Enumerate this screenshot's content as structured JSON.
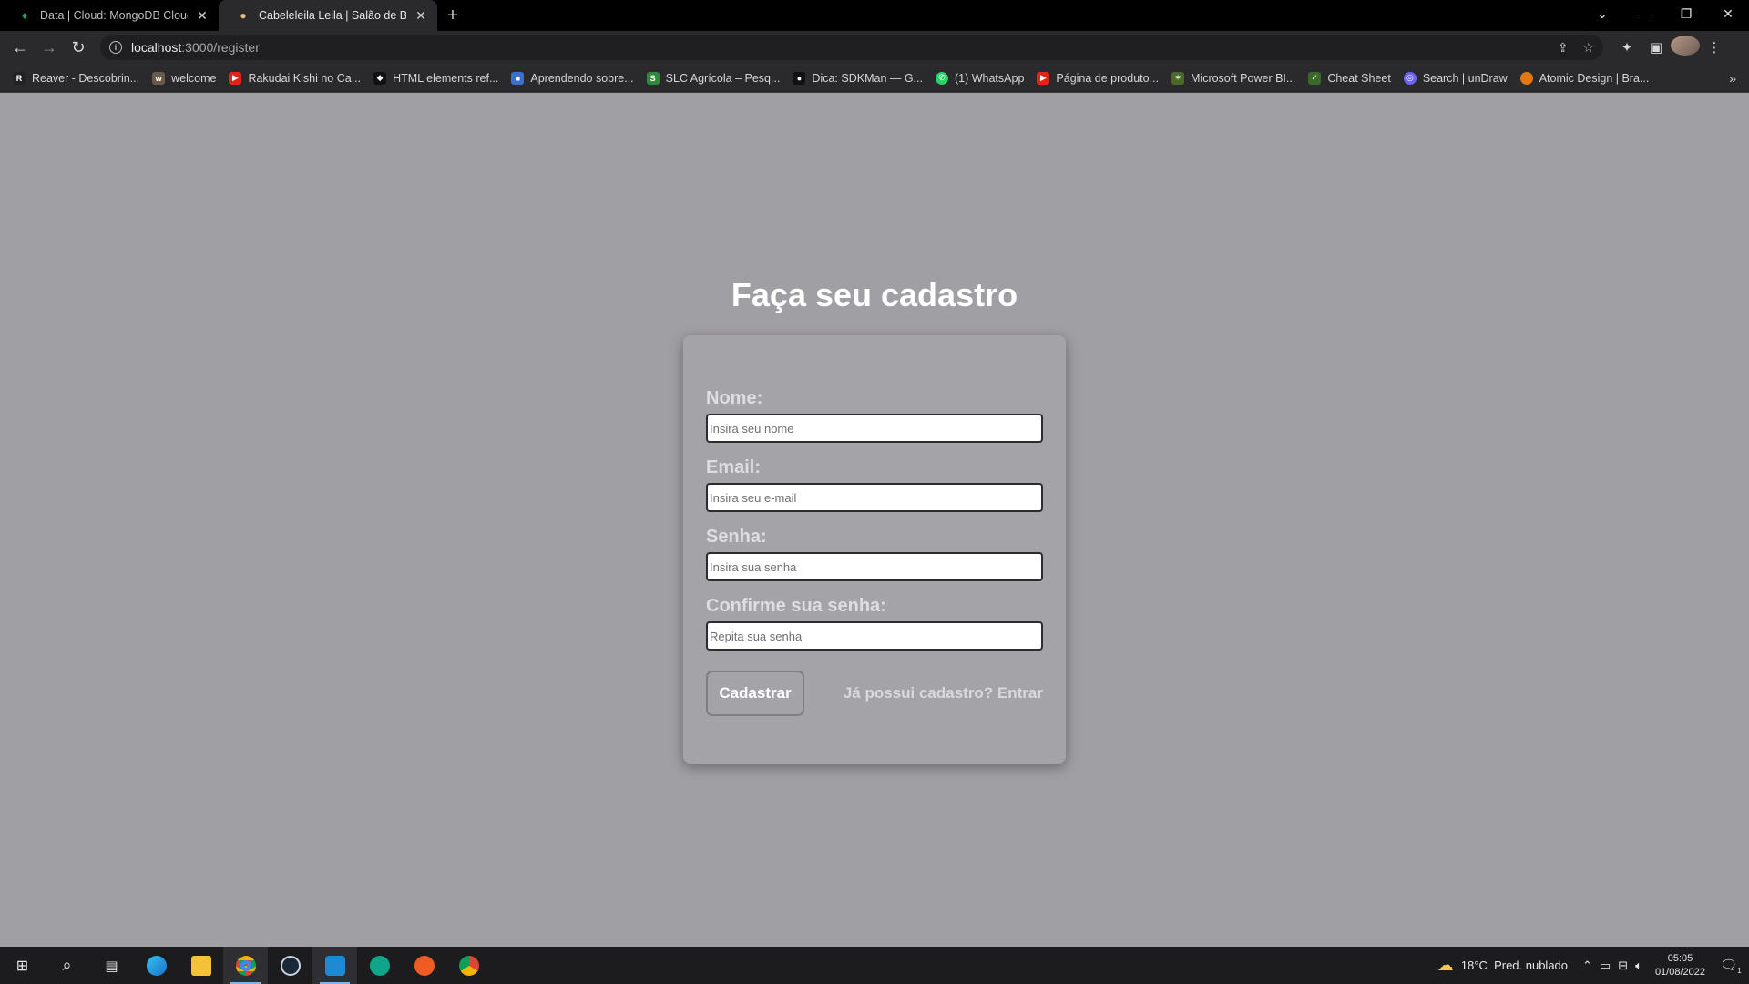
{
  "browser": {
    "tabs": [
      {
        "title": "Data | Cloud: MongoDB Cloud",
        "icon": "leaf-icon",
        "active": false
      },
      {
        "title": "Cabeleleila Leila | Salão de Beleza",
        "icon": "bulb-icon",
        "active": true
      }
    ],
    "url_host": "localhost",
    "url_path": ":3000/register",
    "bookmarks": [
      {
        "label": "Reaver - Descobrin...",
        "color": "#222222"
      },
      {
        "label": "welcome",
        "color": "#6b5a4a"
      },
      {
        "label": "Rakudai Kishi no Ca...",
        "color": "#e62117"
      },
      {
        "label": "HTML elements ref...",
        "color": "#111111"
      },
      {
        "label": "Aprendendo sobre...",
        "color": "#3b6fd1"
      },
      {
        "label": "SLC Agrícola – Pesq...",
        "color": "#2e8b3a"
      },
      {
        "label": "Dica: SDKMan — G...",
        "color": "#111111"
      },
      {
        "label": "(1) WhatsApp",
        "color": "#25d366"
      },
      {
        "label": "Página de produto...",
        "color": "#e62117"
      },
      {
        "label": "Microsoft Power BI...",
        "color": "#4a6a2a"
      },
      {
        "label": "Cheat Sheet",
        "color": "#3a6a2a"
      },
      {
        "label": "Search | unDraw",
        "color": "#6c63ff"
      },
      {
        "label": "Atomic Design | Bra...",
        "color": "#e07a10"
      }
    ]
  },
  "page": {
    "title": "Faça seu cadastro",
    "fields": [
      {
        "label": "Nome:",
        "placeholder": "Insira seu nome"
      },
      {
        "label": "Email:",
        "placeholder": "Insira seu e-mail"
      },
      {
        "label": "Senha:",
        "placeholder": "Insira sua senha"
      },
      {
        "label": "Confirme sua senha:",
        "placeholder": "Repita sua senha"
      }
    ],
    "submit_label": "Cadastrar",
    "login_link": "Já possui cadastro? Entrar"
  },
  "taskbar": {
    "weather_temp": "18°C",
    "weather_desc": "Pred. nublado",
    "time": "05:05",
    "date": "01/08/2022",
    "notifications": "1"
  }
}
